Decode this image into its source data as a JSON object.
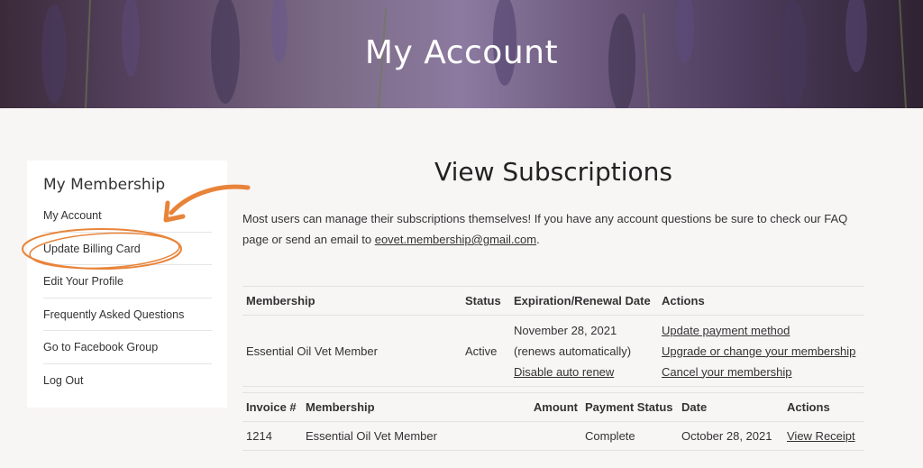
{
  "hero": {
    "title": "My Account"
  },
  "sidebar": {
    "title": "My Membership",
    "items": [
      {
        "label": "My Account"
      },
      {
        "label": "Update Billing Card"
      },
      {
        "label": "Edit Your Profile"
      },
      {
        "label": "Frequently Asked Questions"
      },
      {
        "label": "Go to Facebook Group"
      },
      {
        "label": "Log Out"
      }
    ]
  },
  "main": {
    "title": "View Subscriptions",
    "intro_text": "Most users can manage their subscriptions themselves!  If you have any account questions be sure to check our FAQ page or send an email to ",
    "email": "eovet.membership@gmail.com",
    "intro_end": "."
  },
  "subscriptions": {
    "headers": [
      "Membership",
      "Status",
      "Expiration/Renewal Date",
      "Actions"
    ],
    "row": {
      "membership": "Essential Oil Vet Member",
      "status": "Active",
      "date": "November 28, 2021",
      "renew_note": "(renews automatically)",
      "disable_link": "Disable auto renew",
      "actions": [
        "Update payment method",
        "Upgrade or change your membership",
        "Cancel your membership"
      ]
    }
  },
  "invoices": {
    "headers": [
      "Invoice #",
      "Membership",
      "Amount",
      "Payment Status",
      "Date",
      "Actions"
    ],
    "rows": [
      {
        "invoice": "1214",
        "membership": "Essential Oil Vet Member",
        "amount": "",
        "status": "Complete",
        "date": "October 28, 2021",
        "action": "View Receipt"
      }
    ]
  },
  "colors": {
    "annotation": "#e8843a",
    "hero_purple": "#6b587c"
  }
}
